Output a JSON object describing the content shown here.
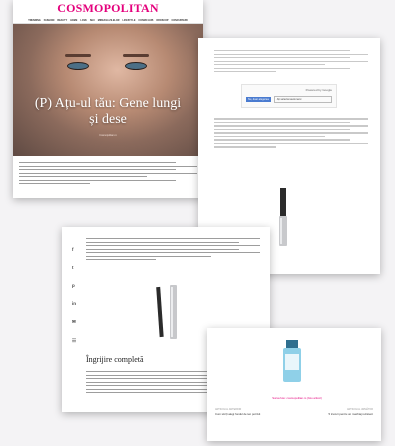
{
  "brand": {
    "logo": "COSMOPOLITAN",
    "color": "#e4007c"
  },
  "nav": [
    "Trending",
    "Fashion",
    "Beauty",
    "Home",
    "Love",
    "Sex",
    "Mireasa Zilelor",
    "Lifestyle",
    "Cosmo Hub",
    "Oroscop",
    "Concursuri"
  ],
  "article": {
    "title": "(P) Ațu-ul tău: Gene lungi și dese",
    "byline": "Cosmopolitan.ro"
  },
  "translate": {
    "powered_by": "Powered by Google",
    "button_label": "Nu, doar alegerea",
    "select_label": "Ați selectat automat ▾"
  },
  "share_icons": [
    "f",
    "t",
    "p",
    "in",
    "✉",
    "☷"
  ],
  "section_heading": "Îngrijire completă",
  "bottom": {
    "link_text": "Sursa foto: cosmopolitan.ro (foto articol)",
    "prev_label": "Articolul anterior",
    "prev_title": "Cum să îți alegi fondul de ten potrivit",
    "next_label": "Articolul următor",
    "next_title": "5 trucuri pentru un machiaj rezistent"
  }
}
